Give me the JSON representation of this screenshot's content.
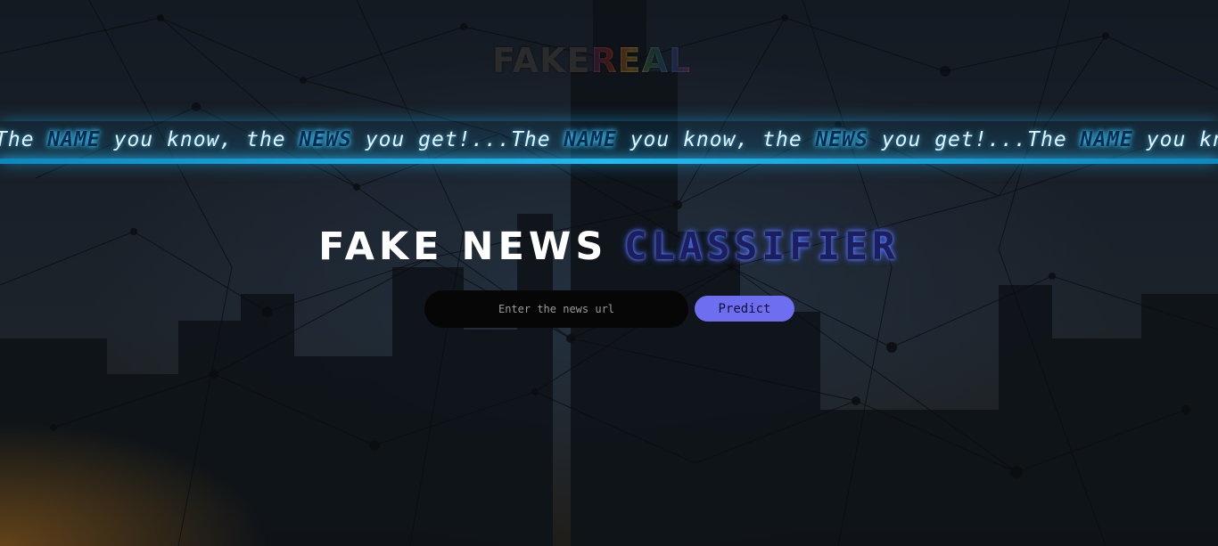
{
  "logo": {
    "fake": "FAKE",
    "real": "REAL"
  },
  "ticker": {
    "segments": [
      {
        "text": "The ",
        "em": false
      },
      {
        "text": "NAME",
        "em": true
      },
      {
        "text": " you know, the ",
        "em": false
      },
      {
        "text": "NEWS",
        "em": true
      },
      {
        "text": " you get!...",
        "em": false
      }
    ],
    "repeat": 3
  },
  "title": {
    "part1": "FAKE NEWS",
    "part2": "CLASSIFIER"
  },
  "search": {
    "placeholder": "Enter the news url",
    "value": ""
  },
  "predict_button": {
    "label": "Predict"
  },
  "colors": {
    "accent_button": "#6e6ef0",
    "ticker_glow": "#23b8ee",
    "title_blue": "#1c1f5e"
  }
}
